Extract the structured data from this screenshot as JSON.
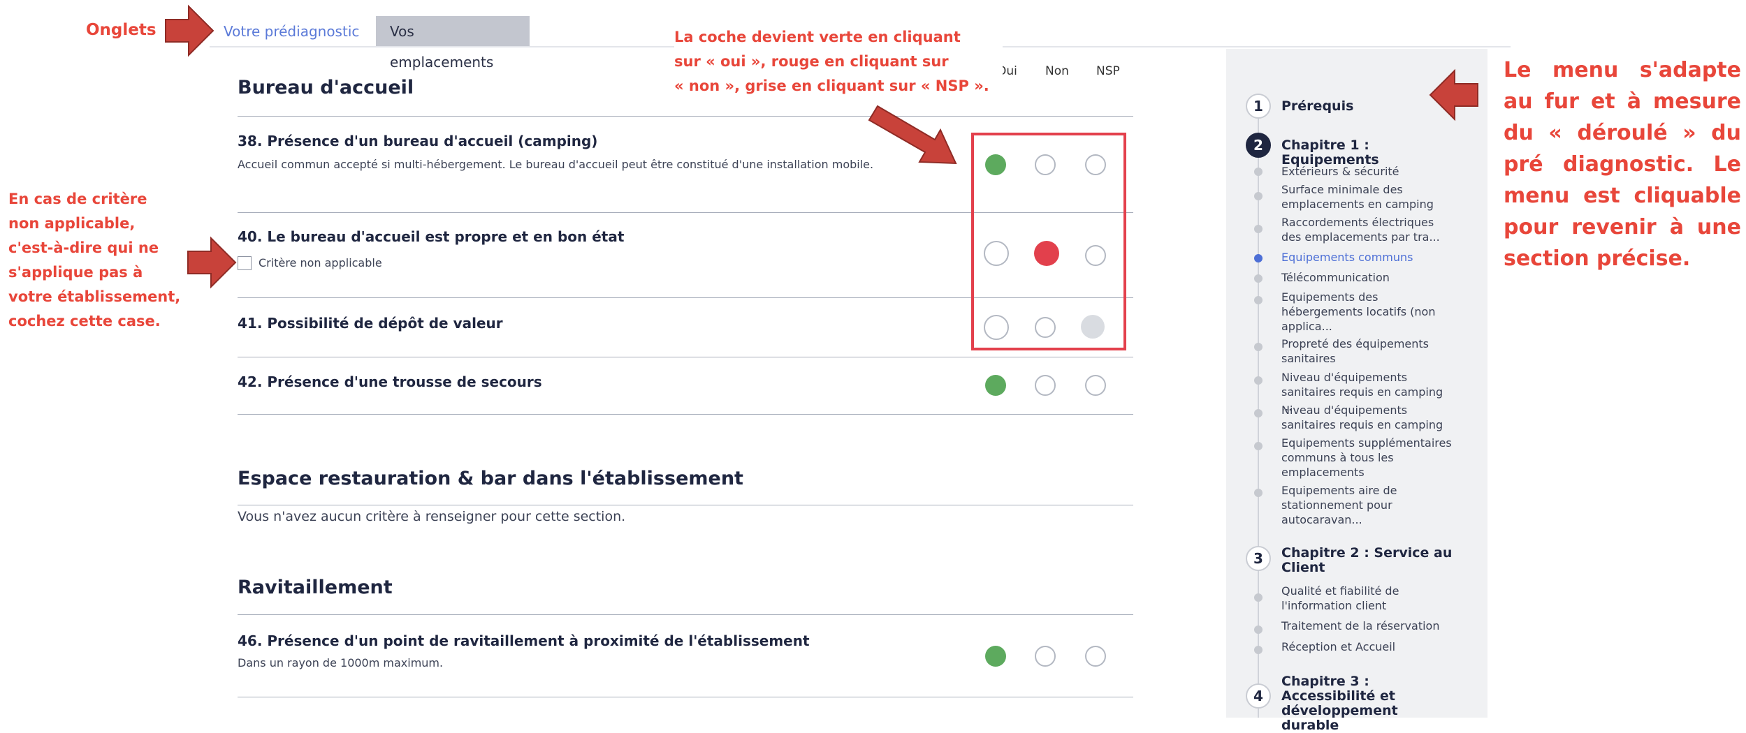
{
  "annotations": {
    "onglets": "Onglets",
    "coche": [
      "La coche devient verte en cliquant",
      "sur « oui », rouge en cliquant sur",
      "« non », grise en cliquant sur « NSP »."
    ],
    "critere": [
      "En cas de critère",
      "non applicable,",
      "c'est-à-dire qui ne",
      "s'applique pas à",
      "votre établissement,",
      "cochez cette case."
    ],
    "menu": "Le menu s'adapte au fur et à mesure du « déroulé » du pré diagnostic. Le menu est cliquable pour revenir à une section précise."
  },
  "tabs": {
    "active": "Votre prédiagnostic",
    "inactive": "Vos emplacements"
  },
  "columns": {
    "oui": "Oui",
    "non": "Non",
    "nsp": "NSP"
  },
  "sections": [
    {
      "title": "Bureau d'accueil",
      "criteria": [
        {
          "title": "38. Présence d'un bureau d'accueil (camping)",
          "desc": "Accueil commun accepté si multi-hébergement. Le bureau d'accueil peut être constitué d'une installation mobile.",
          "answer": "oui"
        },
        {
          "title": "40. Le bureau d'accueil est propre et en bon état",
          "na_label": "Critère non applicable",
          "answer": "non"
        },
        {
          "title": "41. Possibilité de dépôt de valeur",
          "answer": "nsp"
        },
        {
          "title": "42. Présence d'une trousse de secours",
          "answer": "oui"
        }
      ]
    },
    {
      "title": "Espace restauration & bar dans l'établissement",
      "note": "Vous n'avez aucun critère à renseigner pour cette section."
    },
    {
      "title": "Ravitaillement",
      "criteria": [
        {
          "title": "46. Présence d'un point de ravitaillement à proximité de l'établissement",
          "desc": "Dans un rayon de 1000m maximum.",
          "answer": "oui"
        }
      ]
    }
  ],
  "sidebar": {
    "chapters": [
      {
        "num": "1",
        "title": "Prérequis"
      },
      {
        "num": "2",
        "title": "Chapitre 1 : Equipements",
        "current": true,
        "items": [
          "Extérieurs & sécurité",
          "Surface minimale des emplacements en camping",
          "Raccordements électriques des emplacements par tra...",
          "Equipements communs",
          "Télécommunication",
          "Equipements des hébergements locatifs (non applica...",
          "Propreté des équipements sanitaires",
          "Niveau d'équipements sanitaires requis en camping ...",
          "Niveau d'équipements sanitaires requis en camping ...",
          "Equipements supplémentaires communs à tous les emplacements",
          "Equipements aire de stationnement pour autocaravan..."
        ],
        "active_item": 3
      },
      {
        "num": "3",
        "title": "Chapitre 2 : Service au Client",
        "items": [
          "Qualité et fiabilité de l'information client",
          "Traitement de la réservation",
          "Réception et Accueil"
        ]
      },
      {
        "num": "4",
        "title": "Chapitre 3 : Accessibilité et développement durable"
      }
    ]
  },
  "colors": {
    "oui": "#5daa5e",
    "non": "#e2404c",
    "nsp": "#d9dce1",
    "annotation": "#e8463a",
    "link": "#4d6fd6"
  }
}
